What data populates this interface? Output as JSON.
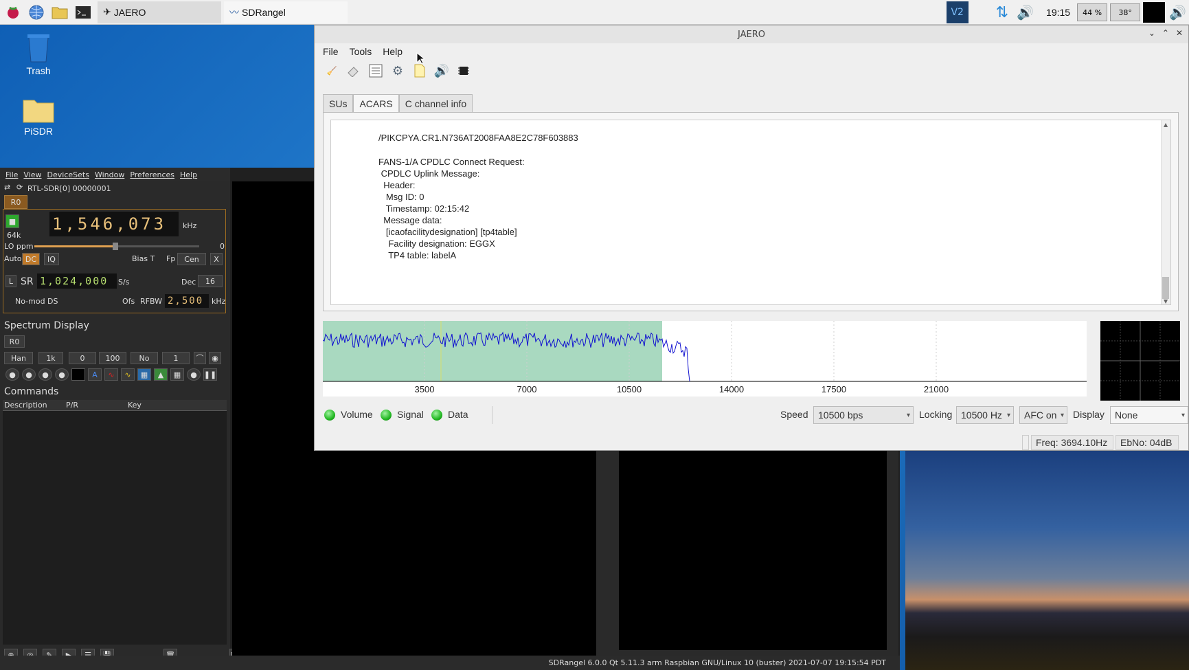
{
  "taskbar": {
    "tasks": [
      {
        "label": "JAERO"
      },
      {
        "label": "SDRangel"
      }
    ],
    "clock": "19:15",
    "cpu": "44 %",
    "temp": "38°"
  },
  "desktop": {
    "icons": [
      {
        "label": "Trash"
      },
      {
        "label": "PiSDR"
      }
    ]
  },
  "jaero": {
    "title": "JAERO",
    "menu": [
      "File",
      "Tools",
      "Help"
    ],
    "tabs": [
      "SUs",
      "ACARS",
      "C channel info"
    ],
    "active_tab": "ACARS",
    "message_lines": [
      "/PIKCPYA.CR1.N736AT2008FAA8E2C78F603883",
      "",
      "FANS-1/A CPDLC Connect Request:",
      " CPDLC Uplink Message:",
      "  Header:",
      "   Msg ID: 0",
      "   Timestamp: 02:15:42",
      "  Message data:",
      "   [icaofacilitydesignation] [tp4table]",
      "    Facility designation: EGGX",
      "    TP4 table: labelA"
    ],
    "spectrum": {
      "ticks": [
        "3500",
        "7000",
        "10500",
        "14000",
        "17500",
        "21000"
      ]
    },
    "indicators": {
      "volume": "Volume",
      "signal": "Signal",
      "data": "Data"
    },
    "speed_label": "Speed",
    "speed_value": "10500 bps",
    "locking_label": "Locking",
    "locking_value": "10500 Hz",
    "afc_value": "AFC on",
    "display_label": "Display",
    "display_value": "None",
    "freq": "Freq: 3694.10Hz",
    "ebno": "EbNo: 04dB",
    "colors": {
      "spectrum_band": "#a9d9c0",
      "spectrum_trace": "#1010d0",
      "led_green": "#22b822"
    }
  },
  "sdrangel": {
    "menu": [
      "File",
      "View",
      "DeviceSets",
      "Window",
      "Preferences",
      "Help"
    ],
    "device": "RTL-SDR[0] 00000001",
    "tab_r0": "R0",
    "frequency": "1,546,073",
    "freq_unit": "kHz",
    "bw": "64k",
    "lo_ppm_label": "LO ppm",
    "lo_ppm_value": "0",
    "auto": "Auto",
    "dc": "DC",
    "iq": "IQ",
    "bias_t": "Bias T",
    "fp_label": "Fp",
    "fp_value": "Cen",
    "x_btn": "X",
    "l_btn": "L",
    "sr_label": "SR",
    "sample_rate": "1,024,000",
    "sr_unit": "S/s",
    "dec_label": "Dec",
    "dec_value": "16",
    "nomod": "No-mod DS",
    "ofs": "Ofs",
    "rfbw_label": "RFBW",
    "rfbw_value": "2,500",
    "rfbw_unit": "kHz",
    "spectrum_title": "Spectrum Display",
    "spec_win": "Han",
    "spec_fft": "1k",
    "spec_v0": "0",
    "spec_v100": "100",
    "spec_no": "No",
    "spec_1": "1",
    "commands_title": "Commands",
    "cmd_cols": [
      "Description",
      "P/R",
      "Key"
    ],
    "status_text": "SDRangel 6.0.0 Qt 5.11.3 arm Raspbian GNU/Linux 10 (buster)  2021-07-07 19:15:54 PDT"
  }
}
